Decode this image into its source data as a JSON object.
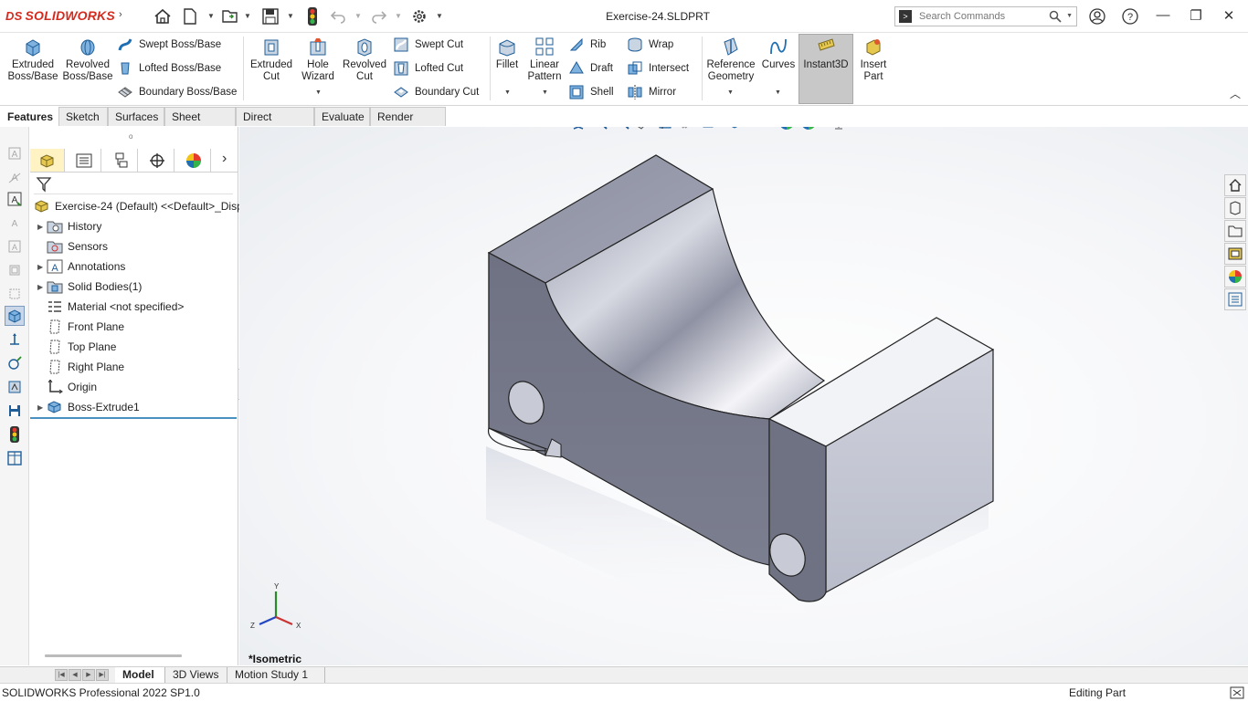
{
  "app": {
    "logo_mark": "DS",
    "logo_text": "SOLIDWORKS",
    "document_title": "Exercise-24.SLDPRT"
  },
  "search": {
    "placeholder": "Search Commands"
  },
  "ribbon": {
    "extruded_boss": "Extruded Boss/Base",
    "revolved_boss": "Revolved Boss/Base",
    "swept_boss": "Swept Boss/Base",
    "lofted_boss": "Lofted Boss/Base",
    "boundary_boss": "Boundary Boss/Base",
    "extruded_cut": "Extruded Cut",
    "hole_wizard": "Hole Wizard",
    "revolved_cut": "Revolved Cut",
    "swept_cut": "Swept Cut",
    "lofted_cut": "Lofted Cut",
    "boundary_cut": "Boundary Cut",
    "fillet": "Fillet",
    "linear_pattern": "Linear Pattern",
    "rib": "Rib",
    "draft": "Draft",
    "shell": "Shell",
    "wrap": "Wrap",
    "intersect": "Intersect",
    "mirror": "Mirror",
    "reference_geometry": "Reference Geometry",
    "curves": "Curves",
    "instant3d": "Instant3D",
    "insert_part": "Insert Part"
  },
  "tabs": [
    "Features",
    "Sketch",
    "Surfaces",
    "Sheet Metal",
    "Direct Editing",
    "Evaluate",
    "Render Tools"
  ],
  "tree": {
    "root": "Exercise-24 (Default) <<Default>_Disp",
    "items": [
      "History",
      "Sensors",
      "Annotations",
      "Solid Bodies(1)",
      "Material <not specified>",
      "Front Plane",
      "Top Plane",
      "Right Plane",
      "Origin",
      "Boss-Extrude1"
    ]
  },
  "viewport": {
    "view_name": "*Isometric",
    "axis_x": "X",
    "axis_y": "Y",
    "axis_z": "Z"
  },
  "bottom_tabs": [
    "Model",
    "3D Views",
    "Motion Study 1"
  ],
  "status": {
    "product": "SOLIDWORKS Professional 2022 SP1.0",
    "mode": "Editing Part"
  },
  "colors": {
    "brand": "#d52b1e",
    "accent_blue": "#1f6fb2",
    "selected_tab": "#c8c8c8"
  }
}
